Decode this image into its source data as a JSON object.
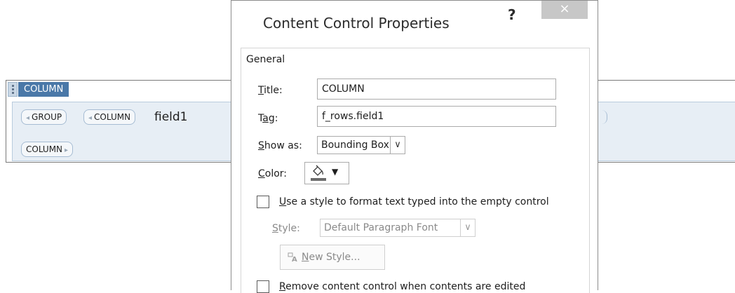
{
  "document": {
    "outer_tag": "COLUMN",
    "group_tag": "GROUP",
    "inner_column_tag": "COLUMN",
    "field_text": "field1",
    "closing_column_tag": "COLUMN"
  },
  "dialog": {
    "title": "Content Control Properties",
    "help": "?",
    "close": "×",
    "group_label": "General",
    "title_label_u": "T",
    "title_label_rest": "itle:",
    "title_value": "COLUMN",
    "tag_label_pre": "T",
    "tag_label_u": "a",
    "tag_label_rest": "g:",
    "tag_value": "f_rows.field1",
    "showas_label_u": "S",
    "showas_label_rest": "how as:",
    "showas_value": "Bounding Box",
    "color_label_u": "C",
    "color_label_rest": "olor:",
    "use_style_u": "U",
    "use_style_rest": "se a style to format text typed into the empty control",
    "style_label_u": "S",
    "style_label_rest": "tyle:",
    "style_value": "Default Paragraph Font",
    "new_style_u": "N",
    "new_style_rest": "ew Style...",
    "remove_u": "R",
    "remove_rest": "emove content control when contents are edited"
  },
  "colors": {
    "tab_blue": "#4a78a8",
    "control_bg": "#e7eef5",
    "close_gray": "#c7c7c7"
  },
  "icons": [
    "paint-bucket-icon",
    "new-style-icon",
    "chevron-down-icon",
    "close-icon",
    "help-icon"
  ]
}
